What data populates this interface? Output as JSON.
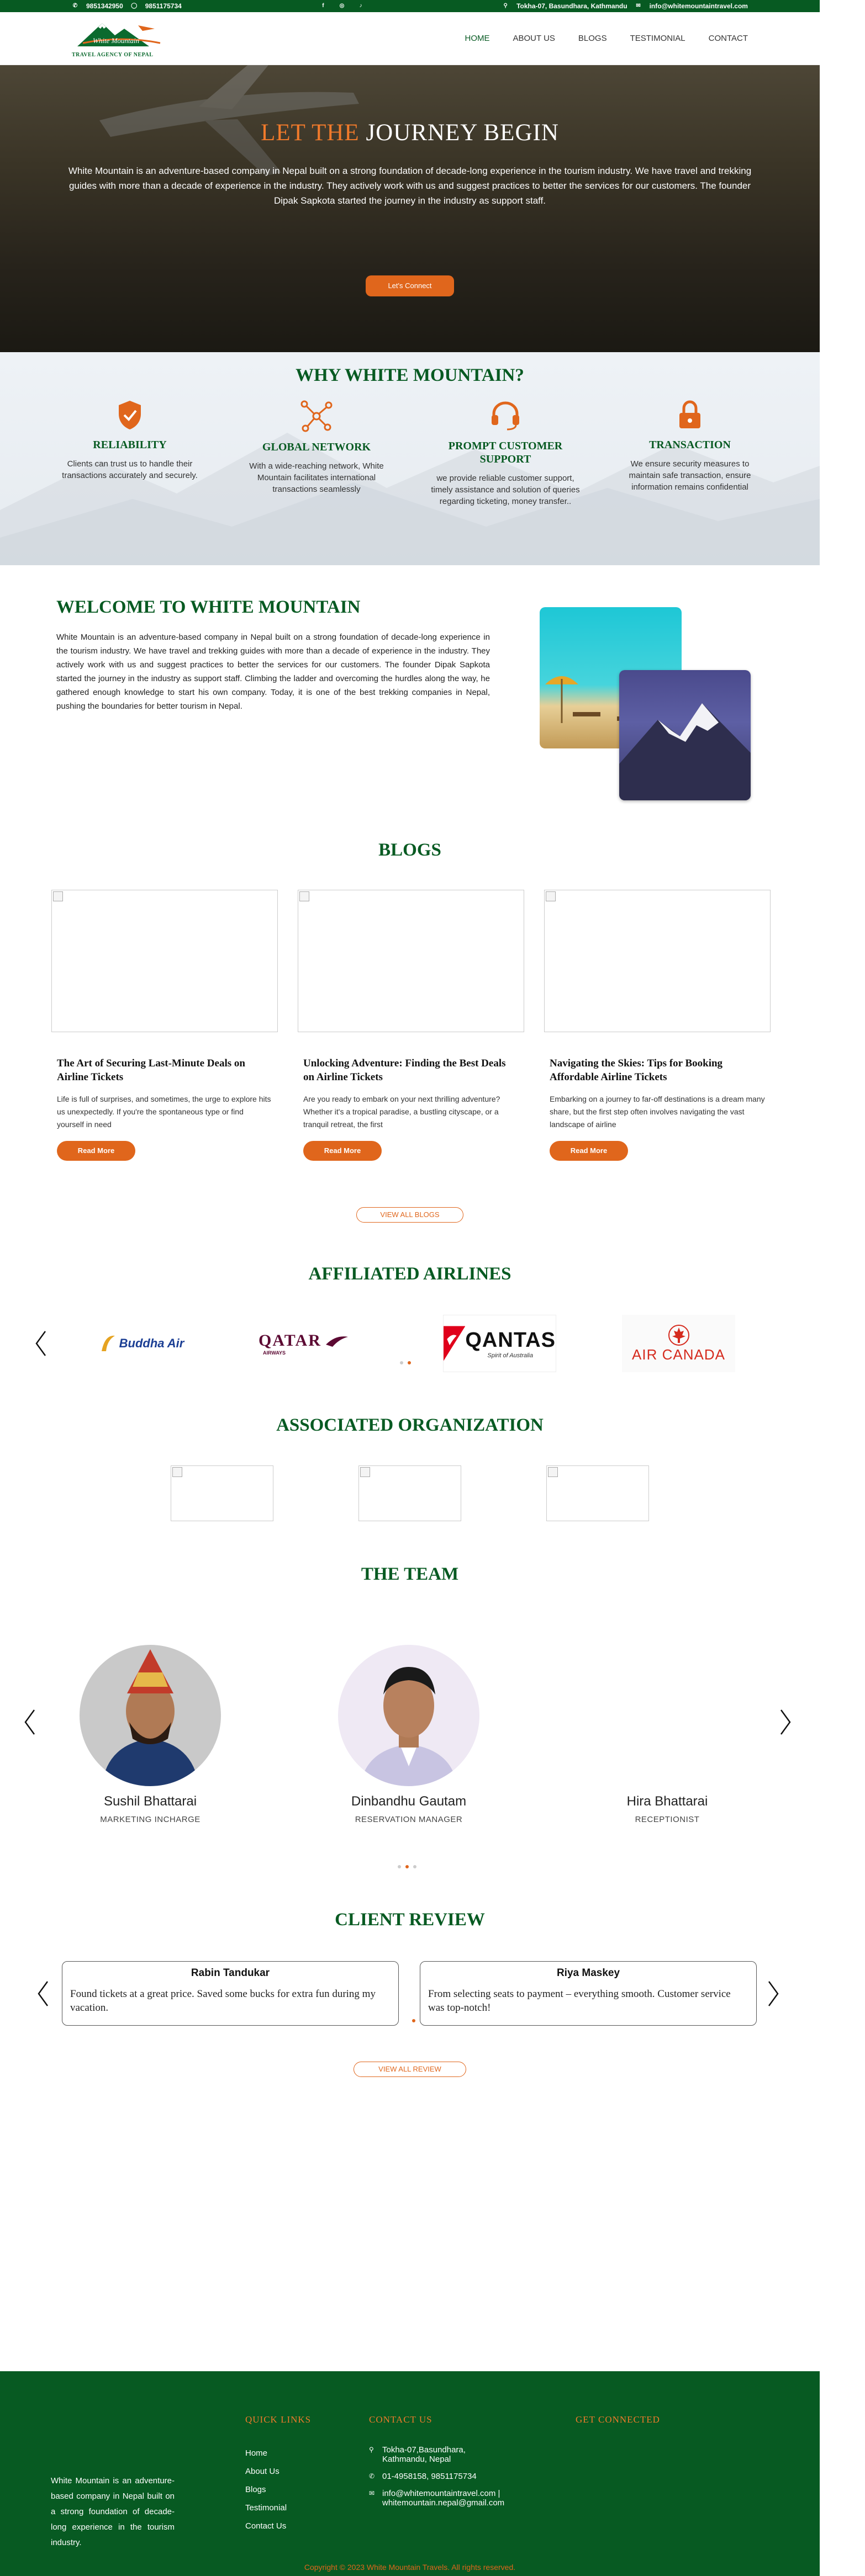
{
  "topbar": {
    "phone1": "9851342950",
    "phone2": "9851175734",
    "address": "Tokha-07, Basundhara, Kathmandu",
    "email": "info@whitemountaintravel.com"
  },
  "logo": {
    "brand": "White Mountain",
    "tagline": "TRAVEL AGENCY OF NEPAL"
  },
  "nav": [
    "HOME",
    "ABOUT US",
    "BLOGS",
    "TESTIMONIAL",
    "CONTACT"
  ],
  "hero": {
    "title_a": "LET THE",
    "title_b": "JOURNEY BEGIN",
    "text": "White Mountain is an adventure-based company in Nepal built on a strong foundation of decade-long experience in the tourism industry. We have travel and trekking guides with more than a decade of experience in the industry. They actively work with us and suggest practices to better the services for our customers. The founder Dipak Sapkota started the journey in the industry as support staff.",
    "cta": "Let's Connect"
  },
  "why": {
    "title": "WHY WHITE MOUNTAIN?",
    "features": [
      {
        "title": "RELIABILITY",
        "text": "Clients can trust us to handle their transactions accurately and securely."
      },
      {
        "title": "GLOBAL NETWORK",
        "text": "With a wide-reaching network, White Mountain facilitates international transactions seamlessly"
      },
      {
        "title": "PROMPT CUSTOMER SUPPORT",
        "text": "we provide reliable customer support, timely assistance and solution of queries regarding ticketing, money transfer.."
      },
      {
        "title": "TRANSACTION",
        "text": "We ensure security measures to maintain safe transaction, ensure information remains confidential"
      }
    ]
  },
  "welcome": {
    "title": "WELCOME TO WHITE MOUNTAIN",
    "text": "White Mountain is an adventure-based company in Nepal built on a strong foundation of decade-long experience in the tourism industry. We have travel and trekking guides with more than a decade of experience in the industry. They actively work with us and suggest practices to better the services for our customers. The founder Dipak Sapkota started the journey in the industry as support staff. Climbing the ladder and overcoming the hurdles along the way, he gathered enough knowledge to start his own company. Today, it is one of the best trekking companies in Nepal, pushing the boundaries for better tourism in Nepal."
  },
  "blogs": {
    "title": "BLOGS",
    "items": [
      {
        "title": "The Art of Securing Last-Minute Deals on Airline Tickets",
        "text": "Life is full of surprises, and sometimes, the urge to explore hits us unexpectedly. If you're the spontaneous type or find yourself in need"
      },
      {
        "title": "Unlocking Adventure: Finding the Best Deals on Airline Tickets",
        "text": "Are you ready to embark on your next thrilling adventure? Whether it's a tropical paradise, a bustling cityscape, or a tranquil retreat, the first"
      },
      {
        "title": "Navigating the Skies: Tips for Booking Affordable Airline Tickets",
        "text": "Embarking on a journey to far-off destinations is a dream many share, but the first step often involves navigating the vast landscape of airline"
      }
    ],
    "read_more": "Read More",
    "view_all": "VIEW ALL BLOGS"
  },
  "airlines": {
    "title": "AFFILIATED AIRLINES",
    "items": [
      "Buddha Air",
      "QATAR",
      "QANTAS",
      "AIR CANADA"
    ],
    "qatar_sub": "AIRWAYS",
    "qantas_sub": "Spirit of Australia"
  },
  "orgs": {
    "title": "ASSOCIATED ORGANIZATION"
  },
  "team": {
    "title": "THE TEAM",
    "members": [
      {
        "name": "Sushil Bhattarai",
        "role": "MARKETING INCHARGE"
      },
      {
        "name": "Dinbandhu Gautam",
        "role": "RESERVATION MANAGER"
      },
      {
        "name": "Hira Bhattarai",
        "role": "RECEPTIONIST"
      }
    ]
  },
  "reviews": {
    "title": "CLIENT REVIEW",
    "items": [
      {
        "name": "Rabin Tandukar",
        "text": "Found tickets at a great price. Saved some bucks for extra fun during my vacation."
      },
      {
        "name": "Riya Maskey",
        "text": "From selecting seats to payment – everything smooth. Customer service was top-notch!"
      }
    ],
    "view_all": "VIEW ALL REVIEW"
  },
  "footer": {
    "about": "White Mountain is an adventure-based company in Nepal built on a strong foundation of decade-long experience in the tourism industry.",
    "quick_links_title": "QUICK LINKS",
    "links": [
      "Home",
      "About Us",
      "Blogs",
      "Testimonial",
      "Contact Us"
    ],
    "contact_title": "CONTACT US",
    "address": "Tokha-07,Basundhara, Kathmandu, Nepal",
    "phones": "01-4958158, 9851175734",
    "emails": "info@whitemountaintravel.com | whitemountain.nepal@gmail.com",
    "connect_title": "GET CONNECTED",
    "copyright": "Copyright © 2023 White Mountain Travels. All rights reserved."
  },
  "colors": {
    "primary_green": "#075a22",
    "accent_orange": "#e0661c"
  }
}
